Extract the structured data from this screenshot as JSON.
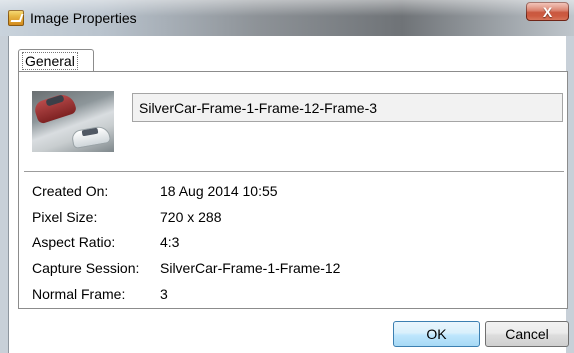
{
  "window": {
    "title": "Image Properties",
    "close_label": "X"
  },
  "tabs": [
    {
      "label": "General",
      "selected": true
    }
  ],
  "image": {
    "name": "SilverCar-Frame-1-Frame-12-Frame-3"
  },
  "properties": [
    {
      "label": "Created On:",
      "value": "18 Aug 2014 10:55"
    },
    {
      "label": "Pixel Size:",
      "value": "720 x 288"
    },
    {
      "label": "Aspect Ratio:",
      "value": "4:3"
    },
    {
      "label": "Capture Session:",
      "value": "SilverCar-Frame-1-Frame-12"
    },
    {
      "label": "Normal Frame:",
      "value": "3"
    }
  ],
  "buttons": {
    "ok": "OK",
    "cancel": "Cancel"
  },
  "colors": {
    "close_button": "#c4452a",
    "ok_button": "#bee6fd",
    "ok_border": "#3c7fb1"
  },
  "icons": {
    "app": "java-app-icon",
    "close": "close-icon"
  }
}
